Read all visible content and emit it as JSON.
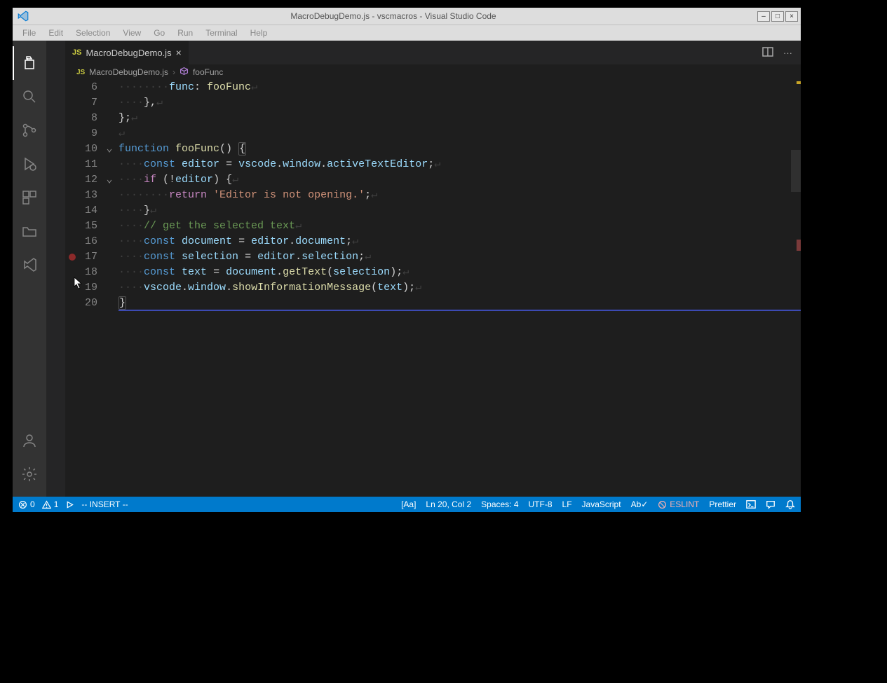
{
  "title": "MacroDebugDemo.js - vscmacros - Visual Studio Code",
  "menu": [
    "File",
    "Edit",
    "Selection",
    "View",
    "Go",
    "Run",
    "Terminal",
    "Help"
  ],
  "tab": {
    "icon": "JS",
    "label": "MacroDebugDemo.js"
  },
  "breadcrumbs": {
    "file": "MacroDebugDemo.js",
    "symbol": "fooFunc",
    "fileIcon": "JS"
  },
  "lines": {
    "start": 6,
    "end": 20,
    "folds": {
      "10": "open",
      "12": "open"
    },
    "breakpoints": [
      17
    ]
  },
  "code": {
    "6": [
      [
        "ws",
        "········"
      ],
      [
        "var",
        "func"
      ],
      [
        "op",
        ": "
      ],
      [
        "fn",
        "fooFunc"
      ],
      [
        "eol",
        "↵"
      ]
    ],
    "7": [
      [
        "ws",
        "····"
      ],
      [
        "punct",
        "},"
      ],
      [
        "eol",
        "↵"
      ]
    ],
    "8": [
      [
        "punct",
        "};"
      ],
      [
        "eol",
        "↵"
      ]
    ],
    "9": [
      [
        "eol",
        "↵"
      ]
    ],
    "10": [
      [
        "kw",
        "function"
      ],
      [
        "punct",
        " "
      ],
      [
        "fn",
        "fooFunc"
      ],
      [
        "punct",
        "() "
      ],
      [
        "brace-hl",
        "{"
      ]
    ],
    "11": [
      [
        "ws",
        "····"
      ],
      [
        "kw",
        "const"
      ],
      [
        "punct",
        " "
      ],
      [
        "var",
        "editor"
      ],
      [
        "punct",
        " "
      ],
      [
        "op",
        "="
      ],
      [
        "punct",
        " "
      ],
      [
        "var",
        "vscode"
      ],
      [
        "punct",
        "."
      ],
      [
        "var",
        "window"
      ],
      [
        "punct",
        "."
      ],
      [
        "var",
        "activeTextEditor"
      ],
      [
        "punct",
        ";"
      ],
      [
        "eol",
        "↵"
      ]
    ],
    "12": [
      [
        "ws",
        "····"
      ],
      [
        "kw2",
        "if"
      ],
      [
        "punct",
        " (!"
      ],
      [
        "var",
        "editor"
      ],
      [
        "punct",
        ") {"
      ],
      [
        "eol",
        "↵"
      ]
    ],
    "13": [
      [
        "ws",
        "········"
      ],
      [
        "kw2",
        "return"
      ],
      [
        "punct",
        " "
      ],
      [
        "str",
        "'Editor is not opening.'"
      ],
      [
        "punct",
        ";"
      ],
      [
        "eol",
        "↵"
      ]
    ],
    "14": [
      [
        "ws",
        "····"
      ],
      [
        "punct",
        "}"
      ],
      [
        "eol",
        "↵"
      ]
    ],
    "15": [
      [
        "ws",
        "····"
      ],
      [
        "cmt",
        "// get the selected text"
      ],
      [
        "eol",
        "↵"
      ]
    ],
    "16": [
      [
        "ws",
        "····"
      ],
      [
        "kw",
        "const"
      ],
      [
        "punct",
        " "
      ],
      [
        "var",
        "document"
      ],
      [
        "punct",
        " "
      ],
      [
        "op",
        "="
      ],
      [
        "punct",
        " "
      ],
      [
        "var",
        "editor"
      ],
      [
        "punct",
        "."
      ],
      [
        "var",
        "document"
      ],
      [
        "punct",
        ";"
      ],
      [
        "eol",
        "↵"
      ]
    ],
    "17": [
      [
        "ws",
        "····"
      ],
      [
        "kw",
        "const"
      ],
      [
        "punct",
        " "
      ],
      [
        "var",
        "selection"
      ],
      [
        "punct",
        " "
      ],
      [
        "op",
        "="
      ],
      [
        "punct",
        " "
      ],
      [
        "var",
        "editor"
      ],
      [
        "punct",
        "."
      ],
      [
        "var",
        "selection"
      ],
      [
        "punct",
        ";"
      ],
      [
        "eol",
        "↵"
      ]
    ],
    "18": [
      [
        "ws",
        "····"
      ],
      [
        "kw",
        "const"
      ],
      [
        "punct",
        " "
      ],
      [
        "var",
        "text"
      ],
      [
        "punct",
        " "
      ],
      [
        "op",
        "="
      ],
      [
        "punct",
        " "
      ],
      [
        "var",
        "document"
      ],
      [
        "punct",
        "."
      ],
      [
        "fn",
        "getText"
      ],
      [
        "punct",
        "("
      ],
      [
        "var",
        "selection"
      ],
      [
        "punct",
        ");"
      ],
      [
        "eol",
        "↵"
      ]
    ],
    "19": [
      [
        "ws",
        "····"
      ],
      [
        "var",
        "vscode"
      ],
      [
        "punct",
        "."
      ],
      [
        "var",
        "window"
      ],
      [
        "punct",
        "."
      ],
      [
        "fn",
        "showInformationMessage"
      ],
      [
        "punct",
        "("
      ],
      [
        "var",
        "text"
      ],
      [
        "punct",
        ");"
      ],
      [
        "eol",
        "↵"
      ]
    ],
    "20": [
      [
        "brace-hl",
        "}"
      ]
    ]
  },
  "status": {
    "errors": "0",
    "warnings": "1",
    "mode": "-- INSERT --",
    "aa": "[Aa]",
    "pos": "Ln 20, Col 2",
    "spaces": "Spaces: 4",
    "encoding": "UTF-8",
    "eol": "LF",
    "lang": "JavaScript",
    "spell": "Ab✓",
    "eslint": "ESLINT",
    "prettier": "Prettier"
  }
}
